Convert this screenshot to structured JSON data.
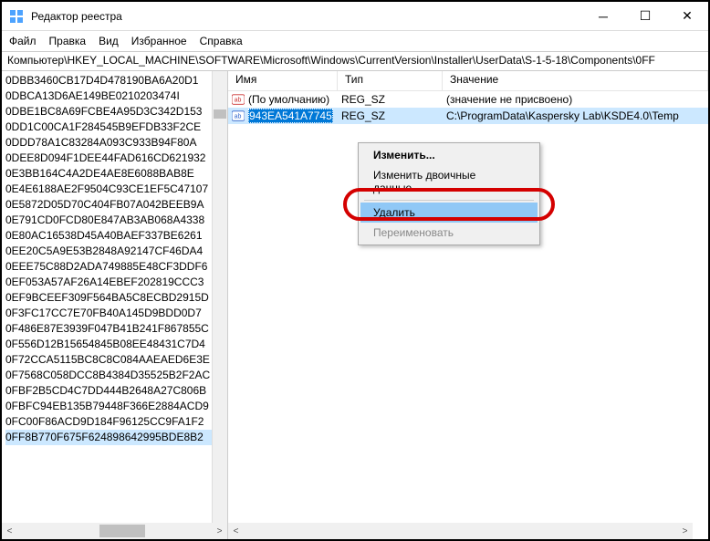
{
  "window": {
    "title": "Редактор реестра"
  },
  "menu": {
    "file": "Файл",
    "edit": "Правка",
    "view": "Вид",
    "favorites": "Избранное",
    "help": "Справка"
  },
  "address": "Компьютер\\HKEY_LOCAL_MACHINE\\SOFTWARE\\Microsoft\\Windows\\CurrentVersion\\Installer\\UserData\\S-1-5-18\\Components\\0FF",
  "tree": [
    "0DBB3460CB17D4D478190BA6A20D1",
    "0DBCA13D6AE149BE0210203474I",
    "0DBE1BC8A69FCBE4A95D3C342D153",
    "0DD1C00CA1F284545B9EFDB33F2CE",
    "0DDD78A1C83284A093C933B94F80A",
    "0DEE8D094F1DEE44FAD616CD621932",
    "0E3BB164C4A2DE4AE8E6088BAB8E",
    "0E4E6188AE2F9504C93CE1EF5C47107",
    "0E5872D05D70C404FB07A042BEEB9A",
    "0E791CD0FCD80E847AB3AB068A4338",
    "0E80AC16538D45A40BAEF337BE6261",
    "0EE20C5A9E53B2848A92147CF46DA4",
    "0EEE75C88D2ADA749885E48CF3DDF6",
    "0EF053A57AF26A14EBEF202819CCC3",
    "0EF9BCEEF309F564BA5C8ECBD2915D",
    "0F3FC17CC7E70FB40A145D9BDD0D7",
    "0F486E87E3939F047B41B241F867855C",
    "0F556D12B15654845B08EE48431C7D4",
    "0F72CCA5115BC8C8C084AAEAED6E3E",
    "0F7568C058DCC8B4384D35525B2F2AC",
    "0FBF2B5CD4C7DD444B2648A27C806B",
    "0FBFC94EB135B79448F366E2884ACD9",
    "0FC00F86ACD9D184F96125CC9FA1F2",
    "0FF8B770F675F624898642995BDE8B2"
  ],
  "tree_selected_index": 23,
  "columns": {
    "name": "Имя",
    "type": "Тип",
    "value": "Значение"
  },
  "rows": [
    {
      "name": "(По умолчанию)",
      "type": "REG_SZ",
      "value": "(значение не присвоено)",
      "icon": "ab-red"
    },
    {
      "name": "943EA541A7745",
      "type": "REG_SZ",
      "value": "C:\\ProgramData\\Kaspersky Lab\\KSDE4.0\\Temp",
      "icon": "ab-blue"
    }
  ],
  "context_menu": {
    "modify": "Изменить...",
    "modify_binary": "Изменить двоичные данные...",
    "delete": "Удалить",
    "rename": "Переименовать"
  }
}
